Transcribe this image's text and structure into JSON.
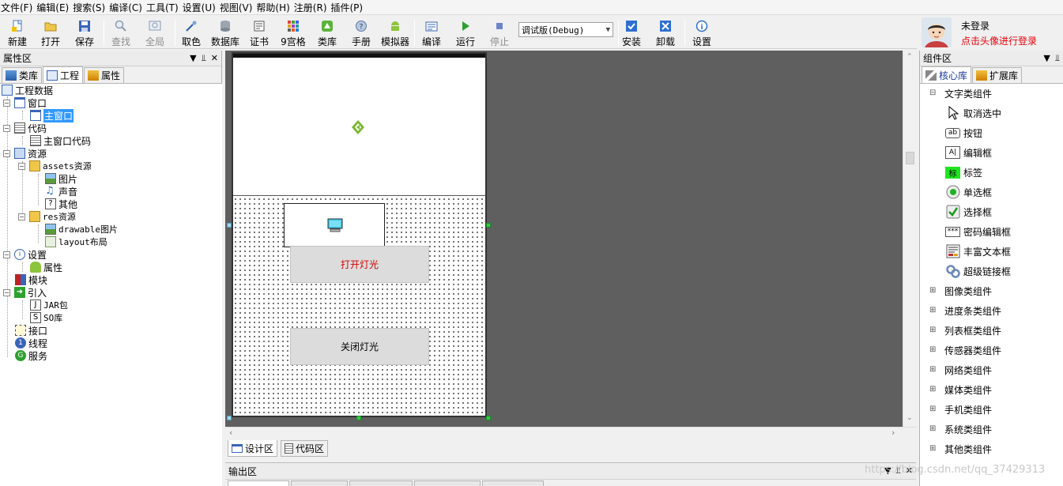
{
  "menu": [
    "文件(F)",
    "编辑(E)",
    "搜索(S)",
    "编译(C)",
    "工具(T)",
    "设置(U)",
    "视图(V)",
    "帮助(H)",
    "注册(R)",
    "插件(P)"
  ],
  "toolbar": {
    "new": "新建",
    "open": "打开",
    "save": "保存",
    "find": "查找",
    "global": "全局",
    "pick_color": "取色",
    "database": "数据库",
    "cert": "证书",
    "grid9": "9宫格",
    "library": "类库",
    "manual": "手册",
    "emulator": "模拟器",
    "compile": "编译",
    "run": "运行",
    "stop": "停止",
    "build_mode": "调试版(Debug)",
    "install": "安装",
    "uninstall": "卸载",
    "settings": "设置"
  },
  "login": {
    "status": "未登录",
    "hint": "点击头像进行登录"
  },
  "left_panel": {
    "title": "属性区",
    "tabs": [
      "类库",
      "工程",
      "属性"
    ],
    "tree": {
      "root": "工程数据",
      "window": "窗口",
      "main_window": "主窗口",
      "code": "代码",
      "main_window_code": "主窗口代码",
      "resources": "资源",
      "assets": "assets资源",
      "images": "图片",
      "sounds": "声音",
      "other": "其他",
      "res": "res资源",
      "drawable": "drawable图片",
      "layout": "layout布局",
      "settings": "设置",
      "properties": "属性",
      "module": "模块",
      "imports": "引入",
      "jar": "JAR包",
      "so": "SO库",
      "interface": "接口",
      "thread": "线程",
      "service": "服务"
    }
  },
  "designer": {
    "btn_on": "打开灯光",
    "btn_off": "关闭灯光",
    "btn_on_color": "#d40000"
  },
  "bottom_tabs": [
    "设计区",
    "代码区"
  ],
  "output": {
    "title": "输出区"
  },
  "right_panel": {
    "title": "组件区",
    "tabs": [
      "核心库",
      "扩展库"
    ],
    "text_group": "文字类组件",
    "items": [
      "取消选中",
      "按钮",
      "编辑框",
      "标签",
      "单选框",
      "选择框",
      "密码编辑框",
      "丰富文本框",
      "超级链接框"
    ],
    "groups": [
      "图像类组件",
      "进度条类组件",
      "列表框类组件",
      "传感器类组件",
      "网络类组件",
      "媒体类组件",
      "手机类组件",
      "系统类组件",
      "其他类组件"
    ]
  },
  "watermark": "https://blog.csdn.net/qq_37429313"
}
